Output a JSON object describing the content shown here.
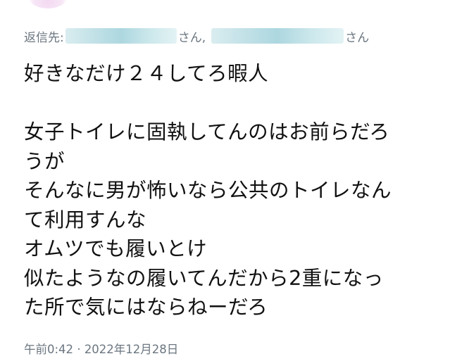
{
  "reply": {
    "prefix": "返信先:",
    "suffix_1": "さん,",
    "suffix_2": "さん"
  },
  "tweet": {
    "lines": [
      "好きなだけ２４してろ暇人",
      "",
      "女子トイレに固執してんのはお前らだろ",
      "うが",
      "そんなに男が怖いなら公共のトイレなん",
      "て利用すんな",
      "オムツでも履いとけ",
      "似たようなの履いてんだから2重になっ",
      "た所で気にはならねーだろ"
    ]
  },
  "meta": {
    "time": "午前0:42",
    "separator": "·",
    "date": "2022年12月28日"
  }
}
